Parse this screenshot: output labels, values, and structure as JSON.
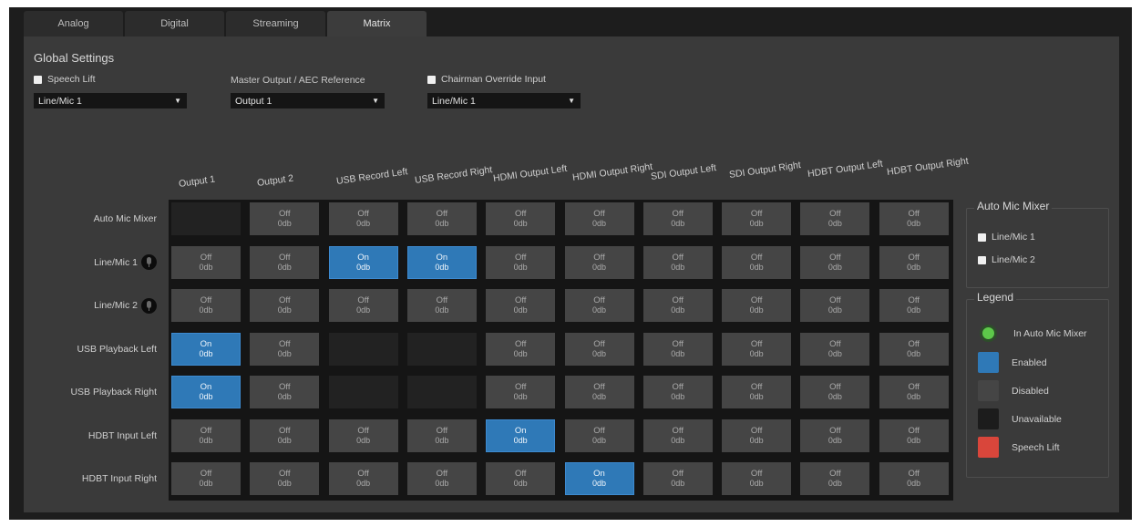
{
  "tabs": [
    {
      "label": "Analog",
      "active": false
    },
    {
      "label": "Digital",
      "active": false
    },
    {
      "label": "Streaming",
      "active": false
    },
    {
      "label": "Matrix",
      "active": true
    }
  ],
  "global_settings": {
    "title": "Global Settings",
    "speech_lift": {
      "label": "Speech Lift",
      "checked": false,
      "select": "Line/Mic 1"
    },
    "master_output": {
      "label": "Master Output / AEC Reference",
      "select": "Output 1"
    },
    "chairman_override": {
      "label": "Chairman Override Input",
      "checked": false,
      "select": "Line/Mic 1"
    }
  },
  "matrix": {
    "columns": [
      "Output 1",
      "Output 2",
      "USB Record Left",
      "USB Record Right",
      "HDMI Output Left",
      "HDMI Output Right",
      "SDI Output Left",
      "SDI Output Right",
      "HDBT Output Left",
      "HDBT Output Right"
    ],
    "rows": [
      {
        "label": "Auto Mic Mixer",
        "mic_icon": false,
        "cells": [
          {
            "state": "unavailable"
          },
          {
            "state": "off",
            "status": "Off",
            "level": "0db"
          },
          {
            "state": "off",
            "status": "Off",
            "level": "0db"
          },
          {
            "state": "off",
            "status": "Off",
            "level": "0db"
          },
          {
            "state": "off",
            "status": "Off",
            "level": "0db"
          },
          {
            "state": "off",
            "status": "Off",
            "level": "0db"
          },
          {
            "state": "off",
            "status": "Off",
            "level": "0db"
          },
          {
            "state": "off",
            "status": "Off",
            "level": "0db"
          },
          {
            "state": "off",
            "status": "Off",
            "level": "0db"
          },
          {
            "state": "off",
            "status": "Off",
            "level": "0db"
          }
        ]
      },
      {
        "label": "Line/Mic 1",
        "mic_icon": true,
        "cells": [
          {
            "state": "off",
            "status": "Off",
            "level": "0db"
          },
          {
            "state": "off",
            "status": "Off",
            "level": "0db"
          },
          {
            "state": "on",
            "status": "On",
            "level": "0db"
          },
          {
            "state": "on",
            "status": "On",
            "level": "0db"
          },
          {
            "state": "off",
            "status": "Off",
            "level": "0db"
          },
          {
            "state": "off",
            "status": "Off",
            "level": "0db"
          },
          {
            "state": "off",
            "status": "Off",
            "level": "0db"
          },
          {
            "state": "off",
            "status": "Off",
            "level": "0db"
          },
          {
            "state": "off",
            "status": "Off",
            "level": "0db"
          },
          {
            "state": "off",
            "status": "Off",
            "level": "0db"
          }
        ]
      },
      {
        "label": "Line/Mic 2",
        "mic_icon": true,
        "cells": [
          {
            "state": "off",
            "status": "Off",
            "level": "0db"
          },
          {
            "state": "off",
            "status": "Off",
            "level": "0db"
          },
          {
            "state": "off",
            "status": "Off",
            "level": "0db"
          },
          {
            "state": "off",
            "status": "Off",
            "level": "0db"
          },
          {
            "state": "off",
            "status": "Off",
            "level": "0db"
          },
          {
            "state": "off",
            "status": "Off",
            "level": "0db"
          },
          {
            "state": "off",
            "status": "Off",
            "level": "0db"
          },
          {
            "state": "off",
            "status": "Off",
            "level": "0db"
          },
          {
            "state": "off",
            "status": "Off",
            "level": "0db"
          },
          {
            "state": "off",
            "status": "Off",
            "level": "0db"
          }
        ]
      },
      {
        "label": "USB Playback Left",
        "mic_icon": false,
        "cells": [
          {
            "state": "on",
            "status": "On",
            "level": "0db"
          },
          {
            "state": "off",
            "status": "Off",
            "level": "0db"
          },
          {
            "state": "unavailable"
          },
          {
            "state": "unavailable"
          },
          {
            "state": "off",
            "status": "Off",
            "level": "0db"
          },
          {
            "state": "off",
            "status": "Off",
            "level": "0db"
          },
          {
            "state": "off",
            "status": "Off",
            "level": "0db"
          },
          {
            "state": "off",
            "status": "Off",
            "level": "0db"
          },
          {
            "state": "off",
            "status": "Off",
            "level": "0db"
          },
          {
            "state": "off",
            "status": "Off",
            "level": "0db"
          }
        ]
      },
      {
        "label": "USB Playback Right",
        "mic_icon": false,
        "cells": [
          {
            "state": "on",
            "status": "On",
            "level": "0db"
          },
          {
            "state": "off",
            "status": "Off",
            "level": "0db"
          },
          {
            "state": "unavailable"
          },
          {
            "state": "unavailable"
          },
          {
            "state": "off",
            "status": "Off",
            "level": "0db"
          },
          {
            "state": "off",
            "status": "Off",
            "level": "0db"
          },
          {
            "state": "off",
            "status": "Off",
            "level": "0db"
          },
          {
            "state": "off",
            "status": "Off",
            "level": "0db"
          },
          {
            "state": "off",
            "status": "Off",
            "level": "0db"
          },
          {
            "state": "off",
            "status": "Off",
            "level": "0db"
          }
        ]
      },
      {
        "label": "HDBT Input Left",
        "mic_icon": false,
        "cells": [
          {
            "state": "off",
            "status": "Off",
            "level": "0db"
          },
          {
            "state": "off",
            "status": "Off",
            "level": "0db"
          },
          {
            "state": "off",
            "status": "Off",
            "level": "0db"
          },
          {
            "state": "off",
            "status": "Off",
            "level": "0db"
          },
          {
            "state": "on",
            "status": "On",
            "level": "0db"
          },
          {
            "state": "off",
            "status": "Off",
            "level": "0db"
          },
          {
            "state": "off",
            "status": "Off",
            "level": "0db"
          },
          {
            "state": "off",
            "status": "Off",
            "level": "0db"
          },
          {
            "state": "off",
            "status": "Off",
            "level": "0db"
          },
          {
            "state": "off",
            "status": "Off",
            "level": "0db"
          }
        ]
      },
      {
        "label": "HDBT Input Right",
        "mic_icon": false,
        "cells": [
          {
            "state": "off",
            "status": "Off",
            "level": "0db"
          },
          {
            "state": "off",
            "status": "Off",
            "level": "0db"
          },
          {
            "state": "off",
            "status": "Off",
            "level": "0db"
          },
          {
            "state": "off",
            "status": "Off",
            "level": "0db"
          },
          {
            "state": "off",
            "status": "Off",
            "level": "0db"
          },
          {
            "state": "on",
            "status": "On",
            "level": "0db"
          },
          {
            "state": "off",
            "status": "Off",
            "level": "0db"
          },
          {
            "state": "off",
            "status": "Off",
            "level": "0db"
          },
          {
            "state": "off",
            "status": "Off",
            "level": "0db"
          },
          {
            "state": "off",
            "status": "Off",
            "level": "0db"
          }
        ]
      }
    ]
  },
  "auto_mic_mixer": {
    "title": "Auto Mic Mixer",
    "items": [
      {
        "label": "Line/Mic 1",
        "checked": false
      },
      {
        "label": "Line/Mic 2",
        "checked": false
      }
    ]
  },
  "legend": {
    "title": "Legend",
    "items": [
      {
        "label": "In Auto Mic Mixer",
        "kind": "dot",
        "color": "#5dc84a"
      },
      {
        "label": "Enabled",
        "kind": "swatch",
        "color": "#2f79b7"
      },
      {
        "label": "Disabled",
        "kind": "swatch",
        "color": "#454545"
      },
      {
        "label": "Unavailable",
        "kind": "swatch",
        "color": "#1c1c1c"
      },
      {
        "label": "Speech Lift",
        "kind": "swatch",
        "color": "#d9463b"
      }
    ]
  }
}
